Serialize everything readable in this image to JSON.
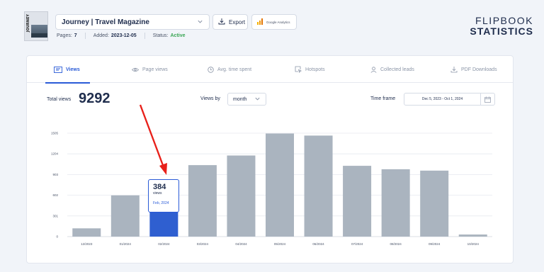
{
  "header": {
    "thumbnail_text": "JOURNEY",
    "flipbook_title": "Journey | Travel Magazine",
    "export_label": "Export",
    "analytics_label": "Google Analytics",
    "meta": {
      "pages_label": "Pages:",
      "pages_value": "7",
      "added_label": "Added:",
      "added_value": "2023-12-05",
      "status_label": "Status:",
      "status_value": "Active"
    },
    "brand_line1": "FLIPBOOK",
    "brand_line2": "STATISTICS"
  },
  "tabs": [
    {
      "label": "Views",
      "icon": "views-icon",
      "active": true
    },
    {
      "label": "Page views",
      "icon": "eye-icon",
      "active": false
    },
    {
      "label": "Avg. time spent",
      "icon": "clock-icon",
      "active": false
    },
    {
      "label": "Hotspots",
      "icon": "cursor-icon",
      "active": false
    },
    {
      "label": "Collected leads",
      "icon": "user-icon",
      "active": false
    },
    {
      "label": "PDF Downloads",
      "icon": "download-icon",
      "active": false
    }
  ],
  "summary": {
    "total_label": "Total views",
    "total_value": "9292",
    "views_by_label": "Views by",
    "views_by_value": "month",
    "timeframe_label": "Time frame",
    "timeframe_value": "Dec 5, 2023 - Oct 1, 2024"
  },
  "tooltip": {
    "value": "384",
    "unit": "views",
    "date": "Feb, 2024"
  },
  "colors": {
    "accent": "#2a5bd7",
    "bar": "#aab4bf",
    "active_bar": "#2f5fd0",
    "status_active": "#3aa655",
    "arrow": "#e8201a"
  },
  "chart_data": {
    "type": "bar",
    "categories": [
      "12/2023",
      "01/2024",
      "02/2024",
      "03/2024",
      "04/2024",
      "05/2024",
      "06/2024",
      "07/2024",
      "08/2024",
      "09/2024",
      "10/2024"
    ],
    "values": [
      120,
      600,
      384,
      1040,
      1180,
      1500,
      1470,
      1030,
      980,
      960,
      30
    ],
    "highlighted_category": "02/2024",
    "yticks": [
      0,
      301,
      602,
      903,
      1204,
      1505
    ],
    "ylim": [
      0,
      1505
    ],
    "grid": true,
    "title": "",
    "xlabel": "",
    "ylabel": ""
  }
}
